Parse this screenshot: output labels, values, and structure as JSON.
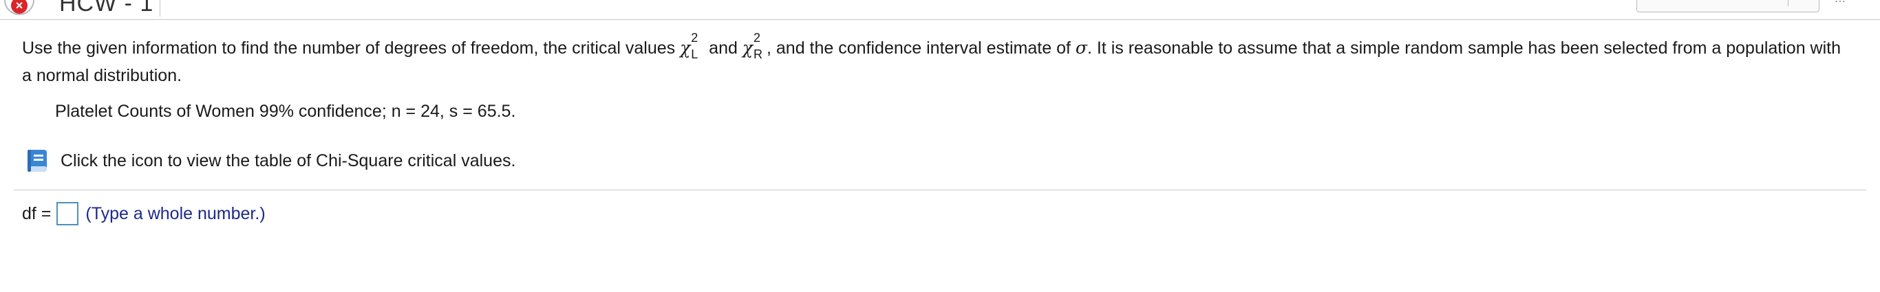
{
  "header": {
    "title_partial": "HCW - 1"
  },
  "question": {
    "part1": "Use the given information to find the number of degrees of freedom, the critical values ",
    "chi_symbol": "χ",
    "sup_left": "2",
    "sub_left": "L",
    "and": " and ",
    "sup_right": "2",
    "sub_right": "R",
    "part2": ", and the confidence interval estimate of ",
    "sigma": "σ",
    "part3": ". It is reasonable to assume that a simple random sample has been selected from a population with a normal distribution."
  },
  "given": {
    "text": "Platelet Counts of Women 99% confidence; n = 24, s = 65.5."
  },
  "table_link": {
    "text": "Click the icon to view the table of Chi-Square critical values.",
    "icon": "book-icon"
  },
  "answer": {
    "label": "df =",
    "value": "",
    "hint": "(Type a whole number.)"
  },
  "colors": {
    "accent_blue": "#4f92b8",
    "hint_text": "#1c2a8c",
    "book_icon": "#3a86d6"
  }
}
